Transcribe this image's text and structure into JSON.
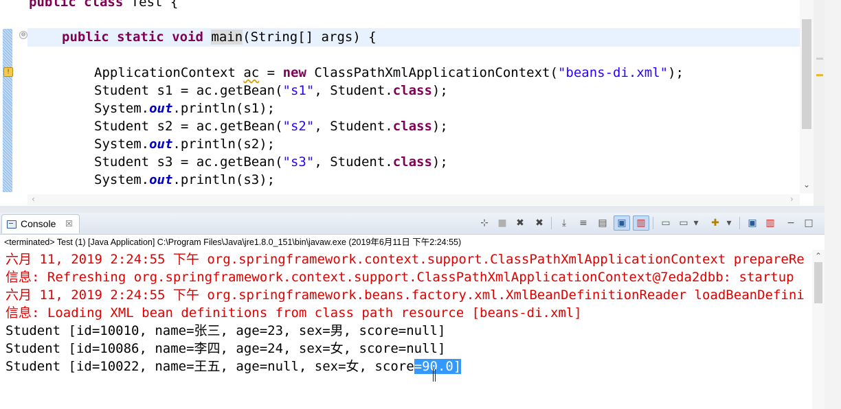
{
  "editor": {
    "lines": [
      [
        "public class Test {"
      ],
      [
        "    public static void main(String[] args) {"
      ],
      [
        ""
      ],
      [
        "        ApplicationContext ac = new ClassPathXmlApplicationContext(\"beans-di.xml\");"
      ],
      [
        "        Student s1 = ac.getBean(\"s1\", Student.class);"
      ],
      [
        "        System.out.println(s1);"
      ],
      [
        "        Student s2 = ac.getBean(\"s2\", Student.class);"
      ],
      [
        "        System.out.println(s2);"
      ],
      [
        "        Student s3 = ac.getBean(\"s3\", Student.class);"
      ],
      [
        "        System.out.println(s3);"
      ]
    ],
    "tokens": {
      "l0_kw1": "public",
      "l0_kw2": "class",
      "l0_rest": " Test {",
      "l1_kw1": "public",
      "l1_kw2": "static",
      "l1_kw3": "void",
      "l1_main": "main",
      "l1_rest": "(String[] args) {",
      "l3_a": "ApplicationContext ",
      "l3_ac": "ac",
      "l3_b": " = ",
      "l3_new": "new",
      "l3_c": " ClassPathXmlApplicationContext(",
      "l3_str": "\"beans-di.xml\"",
      "l3_d": ");",
      "s1_a": "Student s1 = ac.getBean(",
      "s1_str": "\"s1\"",
      "s1_b": ", Student.",
      "s1_cls": "class",
      "s1_c": ");",
      "p1_a": "System.",
      "p1_out": "out",
      "p1_b": ".println(s1);",
      "s2_a": "Student s2 = ac.getBean(",
      "s2_str": "\"s2\"",
      "s2_b": ", Student.",
      "s2_cls": "class",
      "s2_c": ");",
      "p2_a": "System.",
      "p2_out": "out",
      "p2_b": ".println(s2);",
      "s3_a": "Student s3 = ac.getBean(",
      "s3_str": "\"s3\"",
      "s3_b": ", Student.",
      "s3_cls": "class",
      "s3_c": ");",
      "p3_a": "System.",
      "p3_out": "out",
      "p3_b": ".println(s3);"
    },
    "fold_glyph": "⊖",
    "warning_glyph": "!",
    "scroll_down_glyph": "⌄",
    "scroll_left_glyph": "‹",
    "scroll_right_glyph": "›"
  },
  "console": {
    "tab_label": "Console",
    "tab_close": "☒",
    "status": "<terminated> Test (1) [Java Application] C:\\Program Files\\Java\\jre1.8.0_151\\bin\\javaw.exe (2019年6月11日 下午2:24:55)",
    "output": {
      "line1": "六月 11, 2019 2:24:55 下午 org.springframework.context.support.ClassPathXmlApplicationContext prepareRe",
      "line2": "信息: Refreshing org.springframework.context.support.ClassPathXmlApplicationContext@7eda2dbb: startup",
      "line3": "六月 11, 2019 2:24:55 下午 org.springframework.beans.factory.xml.XmlBeanDefinitionReader loadBeanDefini",
      "line4": "信息: Loading XML bean definitions from class path resource [beans-di.xml]",
      "line5": "Student [id=10010, name=张三, age=23, sex=男, score=null]",
      "line6": "Student [id=10086, name=李四, age=24, sex=女, score=null]",
      "line7_a": "Student [id=10022, name=王五, age=null, sex=女, score",
      "line7_sel": "=90.0]"
    },
    "toolbar": {
      "pin": "⊹",
      "terminate": "■",
      "remove": "✖",
      "remove_all": "✖",
      "scroll_lock": "⤓",
      "word_wrap": "≡",
      "show_stdout": "▤",
      "show_stderr": "▥",
      "open_console": "▣",
      "display_selected": "▭",
      "new_console": "✚",
      "dropdown": "▾",
      "minimize": "−",
      "maximize": "□"
    },
    "scroll_up_glyph": "⌃"
  },
  "colors": {
    "keyword": "#7f0055",
    "string": "#2a00ff",
    "field": "#0000c0",
    "error_output": "#e00000",
    "selection": "#3399ff"
  }
}
